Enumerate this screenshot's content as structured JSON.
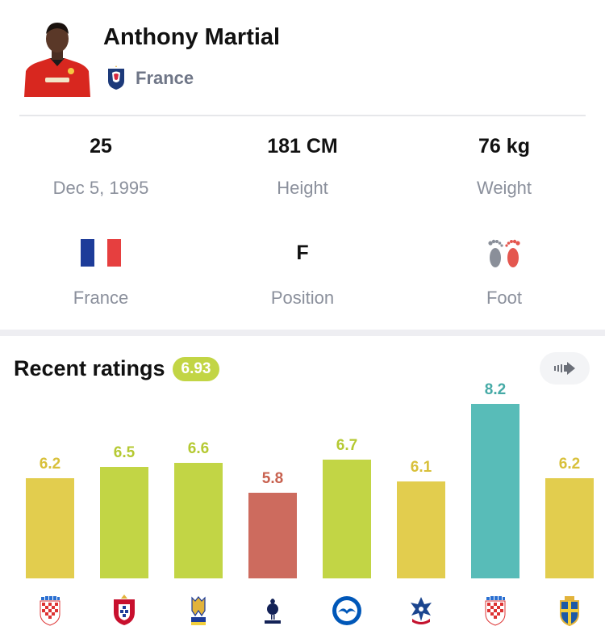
{
  "player": {
    "name": "Anthony Martial",
    "team": "France"
  },
  "info": {
    "age": "25",
    "birthdate": "Dec 5, 1995",
    "height_value": "181 CM",
    "height_label": "Height",
    "weight_value": "76 kg",
    "weight_label": "Weight",
    "nationality_label": "France",
    "position_value": "F",
    "position_label": "Position",
    "foot_label": "Foot"
  },
  "ratings": {
    "title": "Recent ratings",
    "average": "6.93"
  },
  "colors": {
    "low": "#cd6b5e",
    "mid": "#e2cd4e",
    "good": "#c2d545",
    "great": "#58bcb8",
    "flag_blue": "#1d3c99",
    "flag_red": "#e63f3f"
  },
  "chart_data": {
    "type": "bar",
    "categories": [
      "Croatia",
      "Portugal",
      "Ukraine",
      "Tottenham",
      "Brighton",
      "Crystal Palace",
      "Croatia",
      "Sweden"
    ],
    "values": [
      6.2,
      6.5,
      6.6,
      5.8,
      6.7,
      6.1,
      8.2,
      6.2
    ],
    "labels": [
      "6.2",
      "6.5",
      "6.6",
      "5.8",
      "6.7",
      "6.1",
      "8.2",
      "6.2"
    ],
    "opponent_icons": [
      "croatia-crest-icon",
      "portugal-crest-icon",
      "ukraine-crest-icon",
      "tottenham-crest-icon",
      "brighton-crest-icon",
      "crystal-palace-crest-icon",
      "croatia-crest-icon",
      "sweden-crest-icon"
    ]
  }
}
